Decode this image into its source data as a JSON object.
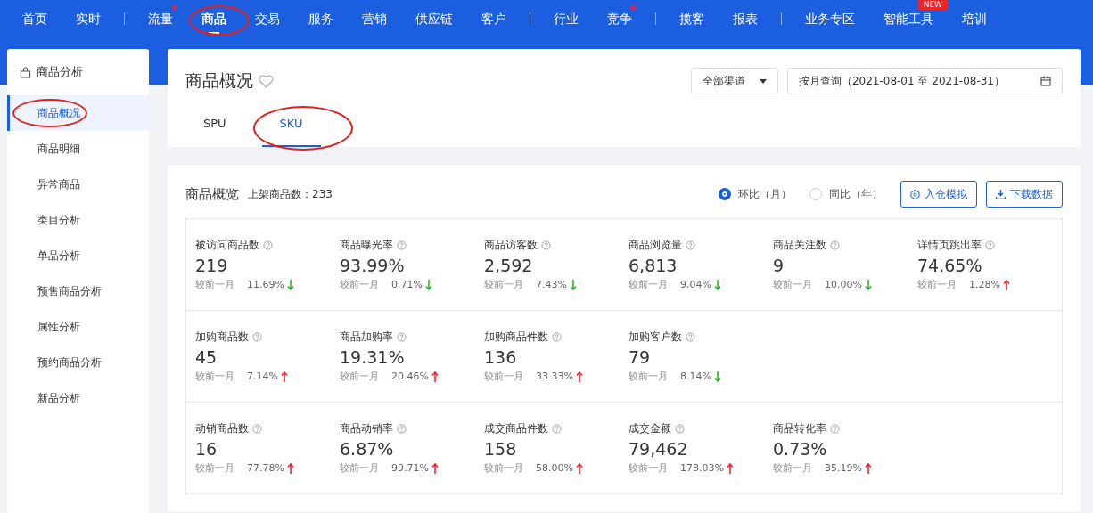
{
  "nav": {
    "groups": [
      [
        {
          "label": "首页",
          "selected": false
        },
        {
          "label": "实时",
          "selected": false
        }
      ],
      [
        {
          "label": "流量",
          "selected": false,
          "dot": true
        },
        {
          "label": "商品",
          "selected": true,
          "circled": true
        },
        {
          "label": "交易",
          "selected": false
        },
        {
          "label": "服务",
          "selected": false
        },
        {
          "label": "营销",
          "selected": false
        },
        {
          "label": "供应链",
          "selected": false
        },
        {
          "label": "客户",
          "selected": false
        }
      ],
      [
        {
          "label": "行业",
          "selected": false
        },
        {
          "label": "竞争",
          "selected": false,
          "dot": true
        }
      ],
      [
        {
          "label": "揽客",
          "selected": false
        },
        {
          "label": "报表",
          "selected": false
        }
      ],
      [
        {
          "label": "业务专区",
          "selected": false
        },
        {
          "label": "智能工具",
          "selected": false,
          "badge": "NEW"
        },
        {
          "label": "培训",
          "selected": false
        }
      ]
    ]
  },
  "sidebar": {
    "title": "商品分析",
    "items": [
      {
        "label": "商品概况",
        "selected": true,
        "circled": true
      },
      {
        "label": "商品明细",
        "selected": false
      },
      {
        "label": "异常商品",
        "selected": false
      },
      {
        "label": "类目分析",
        "selected": false
      },
      {
        "label": "单品分析",
        "selected": false
      },
      {
        "label": "预售商品分析",
        "selected": false
      },
      {
        "label": "属性分析",
        "selected": false
      },
      {
        "label": "预约商品分析",
        "selected": false
      },
      {
        "label": "新品分析",
        "selected": false
      }
    ]
  },
  "header": {
    "title": "商品概况",
    "channel_select": "全部渠道",
    "date_field": "按月查询（2021-08-01 至 2021-08-31）",
    "tabs": [
      {
        "label": "SPU",
        "selected": false
      },
      {
        "label": "SKU",
        "selected": true,
        "circled": true
      }
    ]
  },
  "overview": {
    "title": "商品概览",
    "count": "上架商品数：233",
    "radios": [
      {
        "label": "环比（月）",
        "selected": true
      },
      {
        "label": "同比（年）",
        "selected": false
      }
    ],
    "buttons": [
      {
        "label": "入仓模拟",
        "kind": "settings"
      },
      {
        "label": "下载数据",
        "kind": "download"
      }
    ],
    "rows": [
      [
        {
          "label": "被访问商品数",
          "value": "219",
          "compare": "较前一月",
          "change": "11.69%",
          "increase": false
        },
        {
          "label": "商品曝光率",
          "value": "93.99%",
          "compare": "较前一月",
          "change": "0.71%",
          "increase": false
        },
        {
          "label": "商品访客数",
          "value": "2,592",
          "compare": "较前一月",
          "change": "7.43%",
          "increase": false
        },
        {
          "label": "商品浏览量",
          "value": "6,813",
          "compare": "较前一月",
          "change": "9.04%",
          "increase": false
        },
        {
          "label": "商品关注数",
          "value": "9",
          "compare": "较前一月",
          "change": "10.00%",
          "increase": false
        },
        {
          "label": "详情页跳出率",
          "value": "74.65%",
          "compare": "较前一月",
          "change": "1.28%",
          "increase": true
        }
      ],
      [
        {
          "label": "加购商品数",
          "value": "45",
          "compare": "较前一月",
          "change": "7.14%",
          "increase": true
        },
        {
          "label": "商品加购率",
          "value": "19.31%",
          "compare": "较前一月",
          "change": "20.46%",
          "increase": true
        },
        {
          "label": "加购商品件数",
          "value": "136",
          "compare": "较前一月",
          "change": "33.33%",
          "increase": true
        },
        {
          "label": "加购客户数",
          "value": "79",
          "compare": "较前一月",
          "change": "8.14%",
          "increase": false
        }
      ],
      [
        {
          "label": "动销商品数",
          "value": "16",
          "compare": "较前一月",
          "change": "77.78%",
          "increase": true
        },
        {
          "label": "商品动销率",
          "value": "6.87%",
          "compare": "较前一月",
          "change": "99.71%",
          "increase": true
        },
        {
          "label": "成交商品件数",
          "value": "158",
          "compare": "较前一月",
          "change": "58.00%",
          "increase": true
        },
        {
          "label": "成交金额",
          "value": "79,462",
          "compare": "较前一月",
          "change": "178.03%",
          "increase": true
        },
        {
          "label": "商品转化率",
          "value": "0.73%",
          "compare": "较前一月",
          "change": "35.19%",
          "increase": true
        }
      ]
    ]
  }
}
